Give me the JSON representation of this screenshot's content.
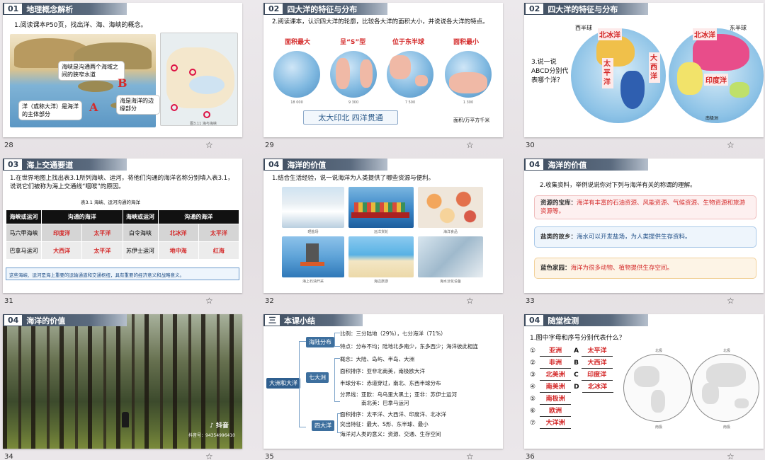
{
  "colors": {
    "header_dark": "#3e4c5e",
    "accent_red": "#d42a2a",
    "ocean_blue": "#69a9d8",
    "tree_blue": "#3d6f9e"
  },
  "slides": [
    {
      "number": "28",
      "badge": "01",
      "title": "地理概念解析",
      "prompt": "1.阅读课本P50页，找出洋、海、海峡的概念。",
      "callouts": [
        "海峡是沟通两个海域之间的狭窄水道",
        "海是海洋的边缘部分",
        "洋（或称大洋）是海洋的主体部分"
      ],
      "letters": [
        "A",
        "B"
      ],
      "map_caption": "图3.11 海与海峡"
    },
    {
      "number": "29",
      "badge": "02",
      "title": "四大洋的特征与分布",
      "prompt": "2.阅读课本，认识四大洋的轮廓，比较各大洋的面积大小，并说说各大洋的特点。",
      "features": [
        "面积最大",
        "呈“S”型",
        "位于东半球",
        "面积最小"
      ],
      "areas": [
        "18 000",
        "9 300",
        "7 500",
        "1 300"
      ],
      "motto": "太大印北  四洋贯通",
      "unit": "面积/万平方千米"
    },
    {
      "number": "30",
      "badge": "02",
      "title": "四大洋的特征与分布",
      "hemispheres": [
        "西半球",
        "东半球"
      ],
      "question": "3.说一说ABCD分别代表哪个洋？",
      "oceans": [
        "北冰洋",
        "太平洋",
        "大西洋",
        "北冰洋",
        "印度洋"
      ],
      "antarctica": "南极洲"
    },
    {
      "number": "31",
      "badge": "03",
      "title": "海上交通要道",
      "prompt": "1.在世界地图上找出表3.1所列海峡、运河，将他们沟通的海洋名称分别填入表3.1，说说它们被称为海上交通线“咽喉”的原因。",
      "table_caption": "表3.1 海峡、运河沟通的海洋",
      "table_headers": [
        "海峡或运河",
        "沟通的海洋",
        "海峡或运河",
        "沟通的海洋"
      ],
      "table_rows": [
        [
          "马六甲海峡",
          "印度洋",
          "太平洋",
          "白令海峡",
          "北冰洋",
          "太平洋"
        ],
        [
          "巴拿马运河",
          "大西洋",
          "太平洋",
          "苏伊士运河",
          "地中海",
          "红海"
        ]
      ],
      "note": "这些海峡、运河是海上重要的运输通道和交通枢纽，具有重要的经济意义和战略意义。"
    },
    {
      "number": "32",
      "badge": "04",
      "title": "海洋的价值",
      "prompt": "1.结合生活经验，说一说海洋为人类提供了哪些资源与便利。",
      "photo_captions": [
        "晒盐场",
        "远洋货轮",
        "海洋食品",
        "海上石油开采",
        "海边旅游",
        "海水淡化设备"
      ]
    },
    {
      "number": "33",
      "badge": "04",
      "title": "海洋的价值",
      "prompt": "2.收集资料，举例说说你对下列与海洋有关的称谓的理解。",
      "cards": [
        {
          "label": "资源的宝库：",
          "text": "海洋有丰富的石油资源、风能资源、气候资源、生物资源和旅游资源等。"
        },
        {
          "label": "盐类的故乡：",
          "text": "海水可以开发盐场，为人类提供生存资料。"
        },
        {
          "label": "蓝色家园：",
          "text": "海洋为很多动物、植物提供生存空间。"
        }
      ]
    },
    {
      "number": "34",
      "badge": "04",
      "title": "海洋的价值",
      "watermark": "抖音",
      "watermark_id": "抖音号：94354996410"
    },
    {
      "number": "35",
      "badge": "三",
      "title": "本课小结",
      "root": "大洲和大洋",
      "branches": [
        "海陆分布",
        "七大洲",
        "四大洋"
      ],
      "items": [
        "比例：三分陆地（29%），七分海洋（71%）",
        "特点：分布不均；陆地北多南少，东多西少；海洋彼此相连",
        "概念：大陆、岛屿、半岛、大洲",
        "面积排序：亚非北南美，南极欧大洋",
        "半球分布：赤道穿过，南北、东西半球分布",
        "分界线：亚欧：乌乌里大黑土；亚非：苏伊士运河",
        "南北美：巴拿马运河",
        "面积排序：太平洋、大西洋、印度洋、北冰洋",
        "突出特征：最大、S形、东半球、最小",
        "海洋对人类的意义：资源、交通、生存空间"
      ]
    },
    {
      "number": "36",
      "badge": "04",
      "title": "随堂检测",
      "prompt": "1.图中字母和序号分别代表什么？",
      "answers": [
        {
          "num": "①",
          "a": "亚洲",
          "letter": "A",
          "b": "太平洋"
        },
        {
          "num": "②",
          "a": "非洲",
          "letter": "B",
          "b": "大西洋"
        },
        {
          "num": "③",
          "a": "北美洲",
          "letter": "C",
          "b": "印度洋"
        },
        {
          "num": "④",
          "a": "南美洲",
          "letter": "D",
          "b": "北冰洋"
        },
        {
          "num": "⑤",
          "a": "南极洲"
        },
        {
          "num": "⑥",
          "a": "欧洲"
        },
        {
          "num": "⑦",
          "a": "大洋洲"
        }
      ],
      "map_labels": [
        "北极",
        "北极",
        "南极",
        "南极"
      ]
    }
  ],
  "star_icon": "☆"
}
